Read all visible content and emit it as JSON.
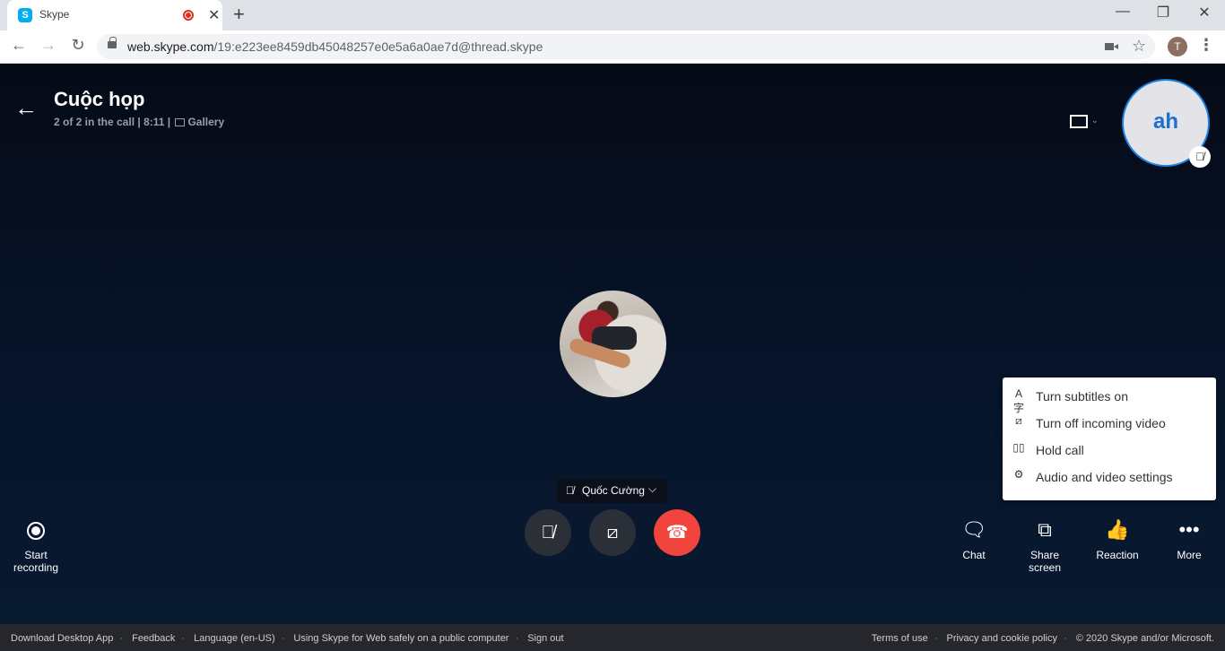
{
  "browser": {
    "tab_title": "Skype",
    "tab_favicon_letter": "S",
    "url_host": "web.skype.com",
    "url_path": "/19:e223ee8459db45048257e0e5a6a0ae7d@thread.skype",
    "profile_initial": "T"
  },
  "call": {
    "title": "Cuộc họp",
    "participants": "2 of 2 in the call",
    "duration": "8:11",
    "view_mode": "Gallery",
    "self_initials": "ah",
    "remote_name": "Quốc Cường",
    "accent_color": "#1a82e2",
    "end_call_color": "#f0443c"
  },
  "controls": {
    "start_recording": [
      "Start",
      "recording"
    ],
    "chat": "Chat",
    "share_screen": [
      "Share",
      "screen"
    ],
    "reaction": "Reaction",
    "more": "More"
  },
  "more_menu": {
    "items": [
      {
        "icon": "subtitles-icon",
        "label": "Turn subtitles on"
      },
      {
        "icon": "video-off-icon",
        "label": "Turn off incoming video"
      },
      {
        "icon": "pause-icon",
        "label": "Hold call"
      },
      {
        "icon": "gear-icon",
        "label": "Audio and video settings"
      }
    ]
  },
  "footer": {
    "left": [
      "Download Desktop App",
      "Feedback",
      "Language (en-US)",
      "Using Skype for Web safely on a public computer",
      "Sign out"
    ],
    "right": [
      "Terms of use",
      "Privacy and cookie policy",
      "© 2020 Skype and/or Microsoft."
    ]
  }
}
